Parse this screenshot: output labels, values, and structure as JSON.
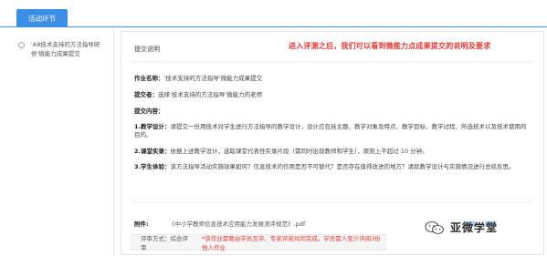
{
  "tabs": {
    "active": "活动环节"
  },
  "sidebar": {
    "items": [
      {
        "label": "'A8技术支持的方法指导研修'微能力成果提交"
      }
    ]
  },
  "panel": {
    "title": "提交说明",
    "annotation": "进入评测之后，我们可以看到微能力点成果提交的说明及要求",
    "work_name_label": "作业名称：",
    "work_name_value": "'技术支持的方法指导'微能力成果提交",
    "submitter_label": "提交者：",
    "submitter_value": "选择'技术支持的方法指导'微能力的老师",
    "content_label": "提交内容：",
    "items": [
      {
        "label": "1.教学设计：",
        "text": "请提交一份用技术对学生进行方法指导的教学设计，设计应包括主题、教学对象及特点、教学目标、教学过程、所选技术以及技术使用的目的。"
      },
      {
        "label": "2.课堂实录：",
        "text": "依据上述教学设计，选取课堂代表性实录片段（需同时出现教师和学生），原则上不超过 10 分钟。"
      },
      {
        "label": "3.学生体验：",
        "text": "该方法指导活动实施效果如何？信息技术的作用是否不可替代？是否存在值得改进的地方？请就教学设计与实施情况进行总结反思。"
      }
    ]
  },
  "attachment": {
    "label": "附件:",
    "file": "《中小学教师信息技术应用能力发展测评规范》.pdf",
    "download": "下载",
    "preview": "预览"
  },
  "evaluation": {
    "label": "评审方式：综合评审",
    "note": "*该作业需要由学员互评、专家评阅共同完成。学员需人至少评阅3份他人作业"
  },
  "watermark": {
    "text": "亚微学堂",
    "icon": "wechat-icon"
  },
  "colors": {
    "accent": "#3c8fe6",
    "alert": "#e53935"
  }
}
